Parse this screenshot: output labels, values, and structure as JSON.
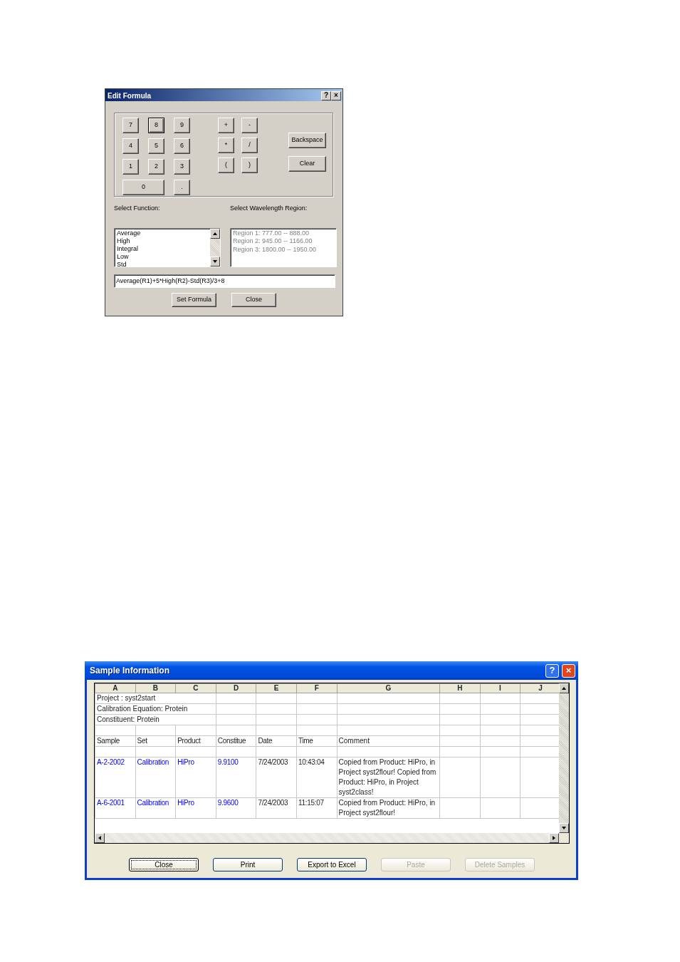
{
  "edit_formula": {
    "title": "Edit Formula",
    "title_buttons": [
      "?",
      "×"
    ],
    "digit_keys": [
      {
        "label": "7",
        "focused": false
      },
      {
        "label": "8",
        "focused": true
      },
      {
        "label": "9",
        "focused": false
      },
      {
        "label": "4",
        "focused": false
      },
      {
        "label": "5",
        "focused": false
      },
      {
        "label": "6",
        "focused": false
      },
      {
        "label": "1",
        "focused": false
      },
      {
        "label": "2",
        "focused": false
      },
      {
        "label": "3",
        "focused": false
      },
      {
        "label": "0",
        "focused": false
      },
      {
        "label": ".",
        "focused": false
      }
    ],
    "operator_keys": [
      "+",
      "-",
      "*",
      "/",
      "(",
      ")"
    ],
    "side_buttons": [
      "Backspace",
      "Clear"
    ],
    "function_label": "Select Function:",
    "functions": [
      "Average",
      "High",
      "Integral",
      "Low",
      "Std"
    ],
    "region_label": "Select Wavelength Region:",
    "regions": {
      "disabled": true,
      "items": [
        "Region 1: 777.00 -- 888.00",
        "Region 2: 945.00 -- 1166.00",
        "Region 3: 1800.00 -- 1950.00"
      ]
    },
    "formula": "Average(R1)+5*High(R2)-Std(R3)/3+8",
    "buttons": [
      "Set Formula",
      "Close"
    ]
  },
  "sample_information": {
    "title": "Sample Information",
    "title_buttons": [
      "?",
      "×"
    ],
    "columns": [
      "A",
      "B",
      "C",
      "D",
      "E",
      "F",
      "G",
      "H",
      "I",
      "J"
    ],
    "rows": [
      {
        "kind": "title",
        "text": "Project : syst2start"
      },
      {
        "kind": "title",
        "text": "Calibration Equation: Protein"
      },
      {
        "kind": "title",
        "text": "Constituent: Protein"
      },
      {
        "kind": "blank"
      },
      {
        "kind": "data",
        "cells": [
          {
            "text": "Sample",
            "kind": "plain"
          },
          {
            "text": "Set",
            "kind": "plain"
          },
          {
            "text": "Product",
            "kind": "plain"
          },
          {
            "text": "Constitue",
            "kind": "plain"
          },
          {
            "text": "Date",
            "kind": "plain"
          },
          {
            "text": "Time",
            "kind": "plain"
          },
          {
            "text": "Comment",
            "kind": "plain"
          }
        ]
      },
      {
        "kind": "blank"
      },
      {
        "kind": "data",
        "cells": [
          {
            "text": "A-2-2002",
            "kind": "link"
          },
          {
            "text": "Calibration",
            "kind": "link"
          },
          {
            "text": "HiPro",
            "kind": "link"
          },
          {
            "text": "9.9100",
            "kind": "link"
          },
          {
            "text": "7/24/2003",
            "kind": "plain"
          },
          {
            "text": "10:43:04",
            "kind": "plain"
          },
          {
            "text": "Copied from Product: HiPro, in Project syst2flour! Copied from Product: HiPro, in Project syst2class!",
            "kind": "plain"
          }
        ]
      },
      {
        "kind": "data",
        "cells": [
          {
            "text": "A-6-2001",
            "kind": "link"
          },
          {
            "text": "Calibration",
            "kind": "link"
          },
          {
            "text": "HiPro",
            "kind": "link"
          },
          {
            "text": "9.9600",
            "kind": "link"
          },
          {
            "text": "7/24/2003",
            "kind": "plain"
          },
          {
            "text": "11:15:07",
            "kind": "plain"
          },
          {
            "text": "Copied from Product: HiPro, in Project syst2flour!",
            "kind": "plain"
          }
        ]
      }
    ],
    "buttons": [
      {
        "label": "Close",
        "default": true,
        "disabled": false
      },
      {
        "label": "Print",
        "default": false,
        "disabled": false
      },
      {
        "label": "Export to Excel",
        "default": false,
        "disabled": false
      },
      {
        "label": "Paste",
        "default": false,
        "disabled": true
      },
      {
        "label": "Delete Samples",
        "default": false,
        "disabled": true
      }
    ]
  }
}
